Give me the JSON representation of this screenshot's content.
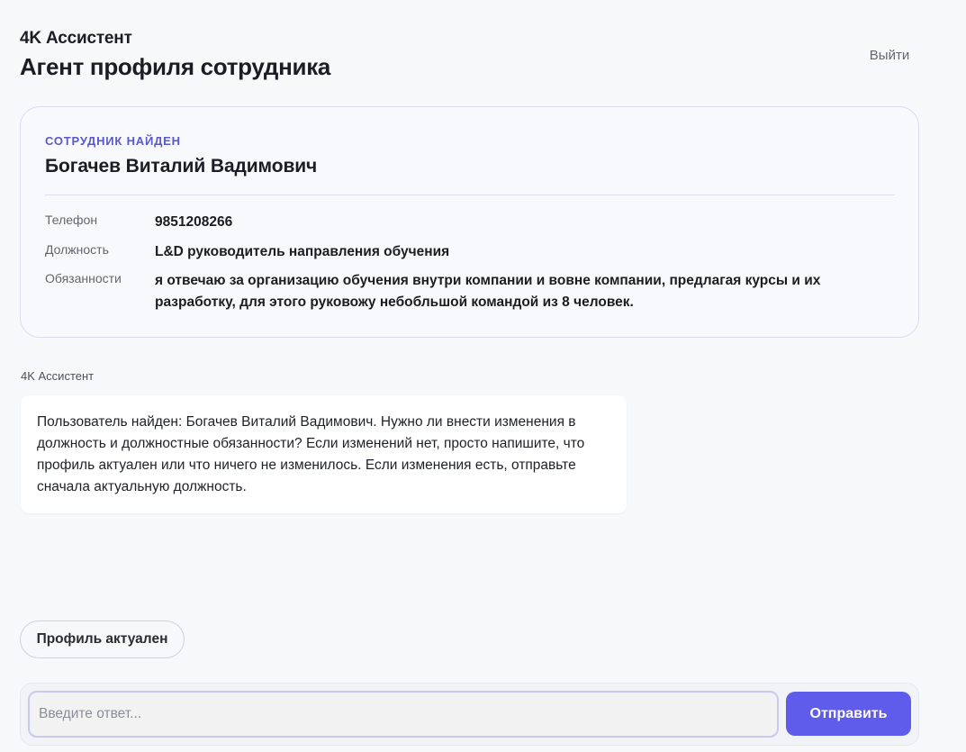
{
  "header": {
    "app_name": "4K Ассистент",
    "page_title": "Агент профиля сотрудника",
    "logout_label": "Выйти"
  },
  "employee_card": {
    "kicker": "СОТРУДНИК НАЙДЕН",
    "name": "Богачев Виталий Вадимович",
    "fields": [
      {
        "label": "Телефон",
        "value": "9851208266"
      },
      {
        "label": "Должность",
        "value": "L&D руководитель направления обучения"
      },
      {
        "label": "Обязанности",
        "value": "я отвечаю за организацию обучения внутри компании и вовне компании, предлагая курсы и их разработку, для этого руковожу небобльшой командой из 8 человек."
      }
    ]
  },
  "chat": {
    "messages": [
      {
        "sender": "4K Ассистент",
        "text": "Пользователь найден: Богачев Виталий Вадимович. Нужно ли внести изменения в должность и должностные обязанности? Если изменений нет, просто напишите, что профиль актуален или что ничего не изменилось. Если изменения есть, отправьте сначала актуальную должность."
      }
    ],
    "quick_replies": [
      "Профиль актуален"
    ]
  },
  "composer": {
    "placeholder": "Введите ответ...",
    "value": "",
    "send_label": "Отправить"
  },
  "colors": {
    "accent": "#5f5ceb",
    "kicker": "#5a59c9",
    "background": "#f7f8fa",
    "card_border": "#d9dcf2"
  }
}
